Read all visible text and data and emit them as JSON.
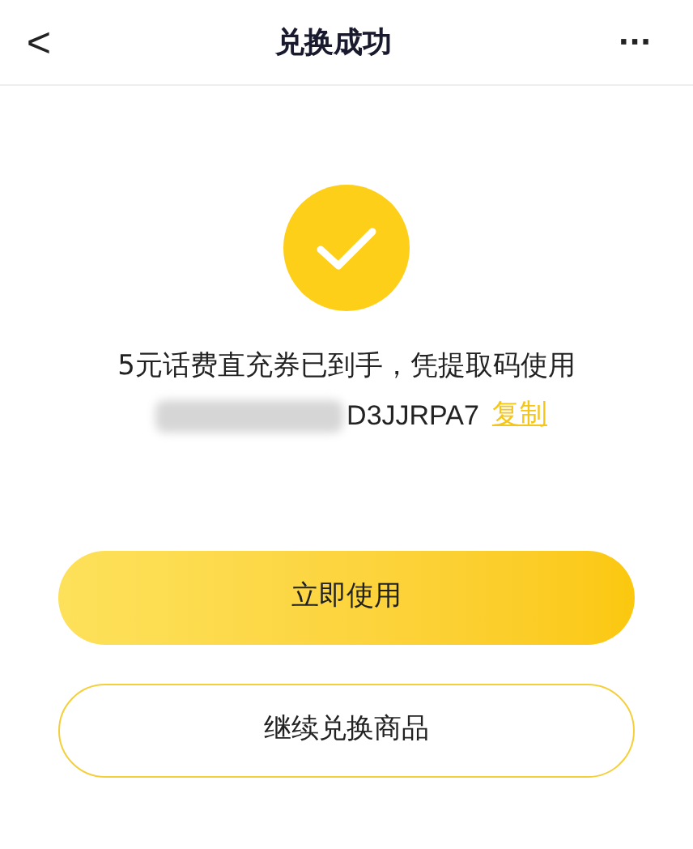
{
  "header": {
    "back": "<",
    "title": "兑换成功",
    "more": "···"
  },
  "message": "5元话费直充券已到手，凭提取码使用",
  "code": {
    "value": "D3JJRPA7",
    "copy": "复制"
  },
  "buttons": [
    {
      "label": "立即使用",
      "kind": "primary"
    },
    {
      "label": "继续兑换商品",
      "kind": "outline"
    }
  ]
}
